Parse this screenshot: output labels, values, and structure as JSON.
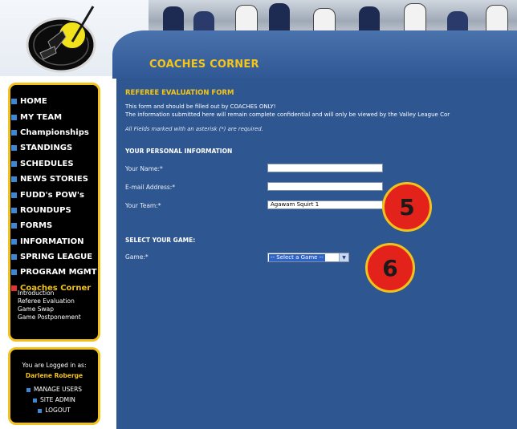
{
  "page": {
    "title": "COACHES CORNER"
  },
  "nav": {
    "items": [
      {
        "label": "HOME"
      },
      {
        "label": "MY TEAM"
      },
      {
        "label": "Championships"
      },
      {
        "label": "STANDINGS"
      },
      {
        "label": "SCHEDULES"
      },
      {
        "label": "NEWS STORIES"
      },
      {
        "label": "FUDD's POW's"
      },
      {
        "label": "ROUNDUPS"
      },
      {
        "label": "FORMS"
      },
      {
        "label": "INFORMATION"
      },
      {
        "label": "SPRING LEAGUE"
      },
      {
        "label": "PROGRAM MGMT"
      },
      {
        "label": "Coaches Corner"
      }
    ],
    "sub_items": [
      {
        "label": "Introduction"
      },
      {
        "label": "Referee Evaluation"
      },
      {
        "label": "Game Swap"
      },
      {
        "label": "Game Postponement"
      }
    ]
  },
  "login": {
    "logged_in_label": "You are Logged in as:",
    "user_name": "Darlene Roberge",
    "links": [
      {
        "label": "MANAGE USERS"
      },
      {
        "label": "SITE ADMIN"
      },
      {
        "label": "LOGOUT"
      }
    ]
  },
  "form": {
    "title": "REFEREE EVALUATION FORM",
    "intro_line1": "This form and should be filled out by COACHES ONLY!",
    "intro_line2": "The information submitted here will remain complete confidential and will only be viewed by the Valley League Cor",
    "required_note": "All Fields marked with an asterisk (*) are required.",
    "personal_heading": "YOUR PERSONAL INFORMATION",
    "name_label": "Your Name:*",
    "name_value": "",
    "email_label": "E-mail Address:*",
    "email_value": "",
    "team_label": "Your Team:*",
    "team_value": "Agawam Squirt 1",
    "game_heading": "SELECT YOUR GAME:",
    "game_label": "Game:*",
    "game_select_value": "-- Select a Game --"
  },
  "badges": {
    "step5": "5",
    "step6": "6"
  },
  "colors": {
    "content_blue": "#2e5690",
    "accent_yellow": "#f5c518",
    "nav_black": "#000000",
    "badge_red": "#e3231b"
  }
}
